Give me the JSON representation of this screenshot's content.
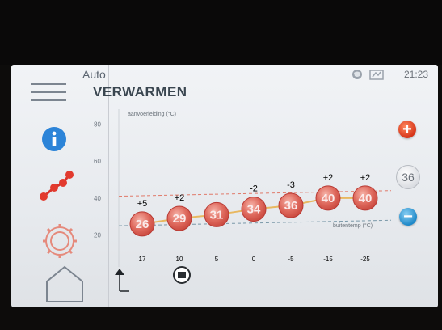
{
  "header": {
    "mode": "Auto",
    "title": "VERWARMEN",
    "time": "21:23"
  },
  "chart_data": {
    "type": "line",
    "title": "",
    "ylabel": "aanvoerleiding (°C)",
    "xlabel": "buitentemp (°C)",
    "ylim": [
      15,
      85
    ],
    "y_ticks": [
      "80",
      "60",
      "40",
      "20"
    ],
    "categories": [
      "17",
      "10",
      "5",
      "0",
      "-5",
      "-15",
      "-25"
    ],
    "series": [
      {
        "values": [
          26,
          29,
          31,
          34,
          36,
          40,
          40
        ]
      }
    ],
    "offsets": [
      "+5",
      "+2",
      "",
      "-2",
      "-3",
      "+2",
      "+2"
    ],
    "grid": false
  },
  "controls": {
    "setpoint": "36",
    "plus": "+",
    "minus": "−"
  },
  "colors": {
    "accent_red": "#d63418",
    "accent_blue": "#1e88c8",
    "info_blue": "#2c84d8",
    "bubble": "#d8574f"
  },
  "icons": {
    "menu": "menu-icon",
    "info": "info-icon",
    "curve": "heating-curve-icon",
    "gear": "gear-icon",
    "home": "home-icon"
  }
}
